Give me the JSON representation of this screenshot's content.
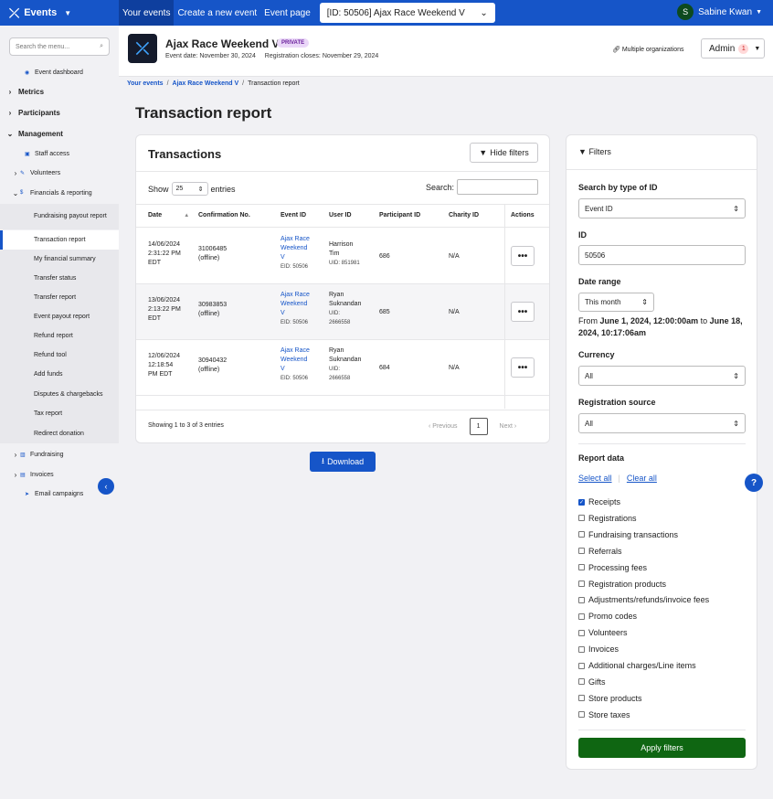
{
  "topbar": {
    "brand": "Events",
    "nav": [
      "Your events",
      "Create a new event",
      "Event page"
    ],
    "event_select": "[ID: 50506] Ajax Race Weekend V",
    "user_initial": "S",
    "user_name": "Sabine Kwan"
  },
  "sidebar": {
    "search_placeholder": "Search the menu...",
    "event_dashboard": "Event dashboard",
    "metrics": "Metrics",
    "participants": "Participants",
    "management": "Management",
    "staff_access": "Staff access",
    "volunteers": "Volunteers",
    "financials": "Financials & reporting",
    "sub_items": [
      "Fundraising payout report",
      "Transaction report",
      "My financial summary",
      "Transfer status",
      "Transfer report",
      "Event payout report",
      "Refund report",
      "Refund tool",
      "Add funds",
      "Disputes & chargebacks",
      "Tax report",
      "Redirect donation"
    ],
    "fundraising": "Fundraising",
    "invoices": "Invoices",
    "email_campaigns": "Email campaigns"
  },
  "event": {
    "title": "Ajax Race Weekend V",
    "badge": "PRIVATE",
    "event_date": "Event date: November 30, 2024",
    "reg_closes": "Registration closes: November 29, 2024",
    "multi_org": "Multiple organizations",
    "admin_label": "Admin",
    "admin_badge": "1"
  },
  "breadcrumb": [
    "Your events",
    "Ajax Race Weekend V",
    "Transaction report"
  ],
  "page_title": "Transaction report",
  "transactions": {
    "title": "Transactions",
    "hide_filters": "Hide filters",
    "show_label": "Show",
    "show_value": "25",
    "entries_label": "entries",
    "search_label": "Search:",
    "columns": [
      "Date",
      "Confirmation No.",
      "Event ID",
      "User ID",
      "Participant ID",
      "Charity ID",
      "Actions"
    ],
    "rows": [
      {
        "date": [
          "14/06/2024",
          "2:31:22 PM",
          "EDT"
        ],
        "confirmation": [
          "31006485",
          "(offline)"
        ],
        "event_link": [
          "Ajax Race",
          "Weekend",
          "V"
        ],
        "eid": "EID: 50506",
        "user": [
          "Harrison",
          "Tim"
        ],
        "uid": [
          "UID: 851981"
        ],
        "participant": "686",
        "charity": "N/A"
      },
      {
        "date": [
          "13/06/2024",
          "2:13:22 PM",
          "EDT"
        ],
        "confirmation": [
          "30983853",
          "(offline)"
        ],
        "event_link": [
          "Ajax Race",
          "Weekend",
          "V"
        ],
        "eid": "EID: 50506",
        "user": [
          "Ryan",
          "Suknandan"
        ],
        "uid": [
          "UID:",
          "2666558"
        ],
        "participant": "685",
        "charity": "N/A"
      },
      {
        "date": [
          "12/06/2024",
          "12:18:54",
          "PM EDT"
        ],
        "confirmation": [
          "30940432",
          "(offline)"
        ],
        "event_link": [
          "Ajax Race",
          "Weekend",
          "V"
        ],
        "eid": "EID: 50506",
        "user": [
          "Ryan",
          "Suknandan"
        ],
        "uid": [
          "UID:",
          "2666558"
        ],
        "participant": "684",
        "charity": "N/A"
      }
    ],
    "showing": "Showing 1 to 3 of 3 entries",
    "prev": "Previous",
    "page": "1",
    "next": "Next",
    "download": "Download"
  },
  "filters": {
    "title": "Filters",
    "search_type_label": "Search by type of ID",
    "search_type_value": "Event ID",
    "id_label": "ID",
    "id_value": "50506",
    "date_range_label": "Date range",
    "date_range_value": "This month",
    "from_word": "From",
    "from_date": "June 1, 2024, 12:00:00am",
    "to_word": "to",
    "to_date": "June 18, 2024, 10:17:06am",
    "currency_label": "Currency",
    "currency_value": "All",
    "reg_source_label": "Registration source",
    "reg_source_value": "All",
    "report_data_label": "Report data",
    "select_all": "Select all",
    "clear_all": "Clear all",
    "checkboxes": [
      {
        "label": "Receipts",
        "checked": true
      },
      {
        "label": "Registrations",
        "checked": false
      },
      {
        "label": "Fundraising transactions",
        "checked": false
      },
      {
        "label": "Referrals",
        "checked": false
      },
      {
        "label": "Processing fees",
        "checked": false
      },
      {
        "label": "Registration products",
        "checked": false
      },
      {
        "label": "Adjustments/refunds/invoice fees",
        "checked": false
      },
      {
        "label": "Promo codes",
        "checked": false
      },
      {
        "label": "Volunteers",
        "checked": false
      },
      {
        "label": "Invoices",
        "checked": false
      },
      {
        "label": "Additional charges/Line items",
        "checked": false
      },
      {
        "label": "Gifts",
        "checked": false
      },
      {
        "label": "Store products",
        "checked": false
      },
      {
        "label": "Store taxes",
        "checked": false
      }
    ],
    "apply": "Apply filters"
  },
  "colors": {
    "primary": "#1655c8",
    "apply_green": "#0f6612"
  }
}
